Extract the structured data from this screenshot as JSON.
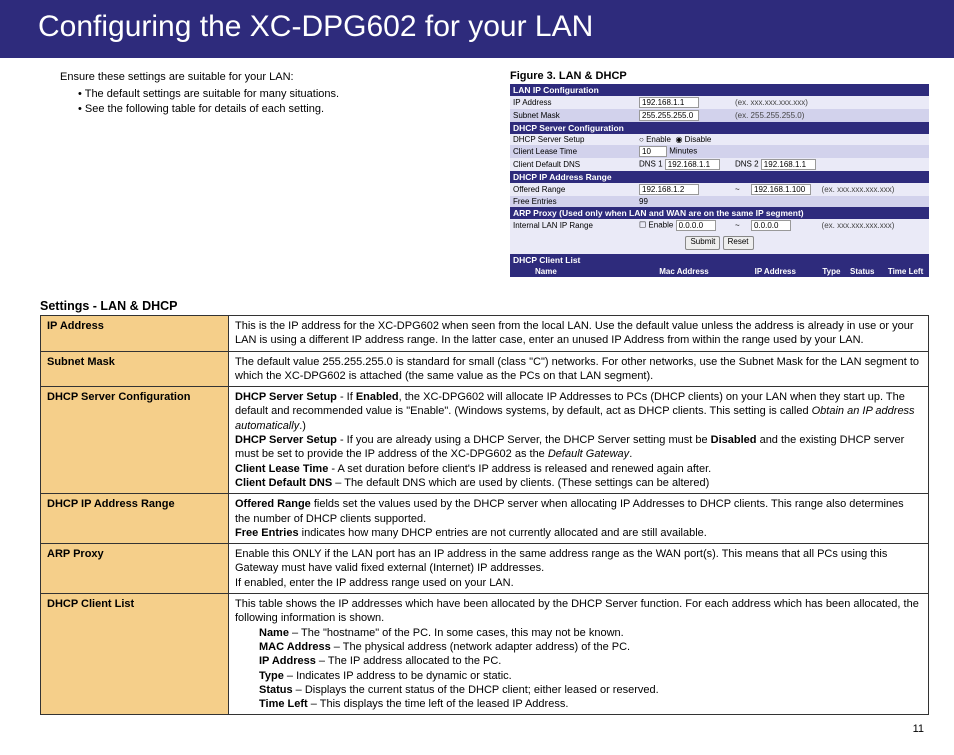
{
  "title": "Configuring the XC-DPG602 for your LAN",
  "page_number": "11",
  "intro": {
    "lead": "Ensure these settings are suitable for your LAN:",
    "bullets": [
      "The default settings are suitable for many situations.",
      "See the following table for details of each setting."
    ]
  },
  "figure": {
    "caption": "Figure 3. LAN & DHCP",
    "sections": {
      "lan_ip": {
        "header": "LAN IP Configuration",
        "ip_label": "IP Address",
        "ip_value": "192.168.1.1",
        "ip_hint": "(ex. xxx.xxx.xxx.xxx)",
        "mask_label": "Subnet Mask",
        "mask_value": "255.255.255.0",
        "mask_hint": "(ex. 255.255.255.0)"
      },
      "dhcp_server": {
        "header": "DHCP Server Configuration",
        "setup_label": "DHCP Server Setup",
        "enable": "Enable",
        "disable": "Disable",
        "lease_label": "Client Lease Time",
        "lease_value": "10",
        "lease_unit": "Minutes",
        "dns_label": "Client Default DNS",
        "dns1_label": "DNS 1",
        "dns1_value": "192.168.1.1",
        "dns2_label": "DNS 2",
        "dns2_value": "192.168.1.1"
      },
      "dhcp_range": {
        "header": "DHCP IP Address Range",
        "offered_label": "Offered Range",
        "offered_from": "192.168.1.2",
        "tilde": "~",
        "offered_to": "192.168.1.100",
        "offered_hint": "(ex. xxx.xxx.xxx.xxx)",
        "free_label": "Free Entries",
        "free_value": "99"
      },
      "arp": {
        "header": "ARP Proxy (Used only when LAN and WAN are on the same IP segment)",
        "label": "Internal LAN IP Range",
        "enable": "Enable",
        "from": "0.0.0.0",
        "tilde": "~",
        "to": "0.0.0.0",
        "hint": "(ex. xxx.xxx.xxx.xxx)"
      },
      "buttons": {
        "submit": "Submit",
        "reset": "Reset"
      },
      "client_list": {
        "header": "DHCP Client List",
        "cols": [
          "Name",
          "Mac Address",
          "IP Address",
          "Type",
          "Status",
          "Time Left"
        ]
      }
    }
  },
  "settings": {
    "title": "Settings - LAN & DHCP",
    "rows": {
      "ip": {
        "label": "IP Address",
        "text": "This is the IP address for the XC-DPG602 when seen from the local LAN. Use the default value unless the address is already in use or your LAN is using a different IP address range. In the latter case, enter an unused IP Address from within the range used by your LAN."
      },
      "mask": {
        "label": "Subnet Mask",
        "text": "The default value 255.255.255.0 is standard for small (class \"C\") networks. For other networks, use the Subnet Mask for the LAN segment to which the XC-DPG602 is attached (the same value as the PCs on that LAN segment)."
      },
      "dhcp_conf": {
        "label": "DHCP Server Configuration",
        "p1a": "DHCP Server Setup",
        "p1b": " - If ",
        "p1c": "Enabled",
        "p1d": ", the XC-DPG602 will allocate IP Addresses to PCs (DHCP clients) on your LAN when they start up. The default and recommended value is \"Enable\". (Windows systems, by default, act as DHCP clients. This setting is called ",
        "p1e": "Obtain an IP address automatically",
        "p1f": ".)",
        "p2a": "DHCP Server Setup",
        "p2b": " - If you are already using a DHCP Server, the DHCP Server setting must be ",
        "p2c": "Disabled",
        "p2d": " and the existing DHCP server must be set to provide the IP address of the XC-DPG602 as the ",
        "p2e": "Default Gateway",
        "p2f": ".",
        "p3a": "Client Lease Time",
        "p3b": " - A set duration before client's IP address is released and renewed again after.",
        "p4a": "Client Default DNS",
        "p4b": " – The default DNS which are used by clients. (These settings can be altered)"
      },
      "dhcp_range": {
        "label": "DHCP IP Address Range",
        "p1a": "Offered Range",
        "p1b": " fields set the values used by the DHCP server when allocating IP Addresses to DHCP clients. This range also determines the number of DHCP clients supported.",
        "p2a": "Free Entries",
        "p2b": " indicates how many DHCP entries are not currently allocated and are still available."
      },
      "arp": {
        "label": "ARP Proxy",
        "p1": "Enable this ONLY if the LAN port has an IP address in the same address range as the WAN port(s). This means that all PCs using this Gateway must have valid fixed external (Internet) IP addresses.",
        "p2": "If enabled, enter the IP address range used on your LAN."
      },
      "clients": {
        "label": "DHCP Client List",
        "intro": "This table shows the IP addresses which have been allocated by the DHCP Server function. For each address which has been allocated, the following information is shown.",
        "l1a": "Name",
        "l1b": " – The \"hostname\" of the PC. In some cases, this may not be known.",
        "l2a": "MAC Address",
        "l2b": " – The physical address (network adapter address) of the PC.",
        "l3a": "IP Address",
        "l3b": " – The IP address allocated to the PC.",
        "l4a": "Type",
        "l4b": " – Indicates IP address to be dynamic or static.",
        "l5a": "Status",
        "l5b": " – Displays the current status of the DHCP client; either leased or reserved.",
        "l6a": "Time Left",
        "l6b": " – This displays the time left of the leased IP Address."
      }
    }
  }
}
